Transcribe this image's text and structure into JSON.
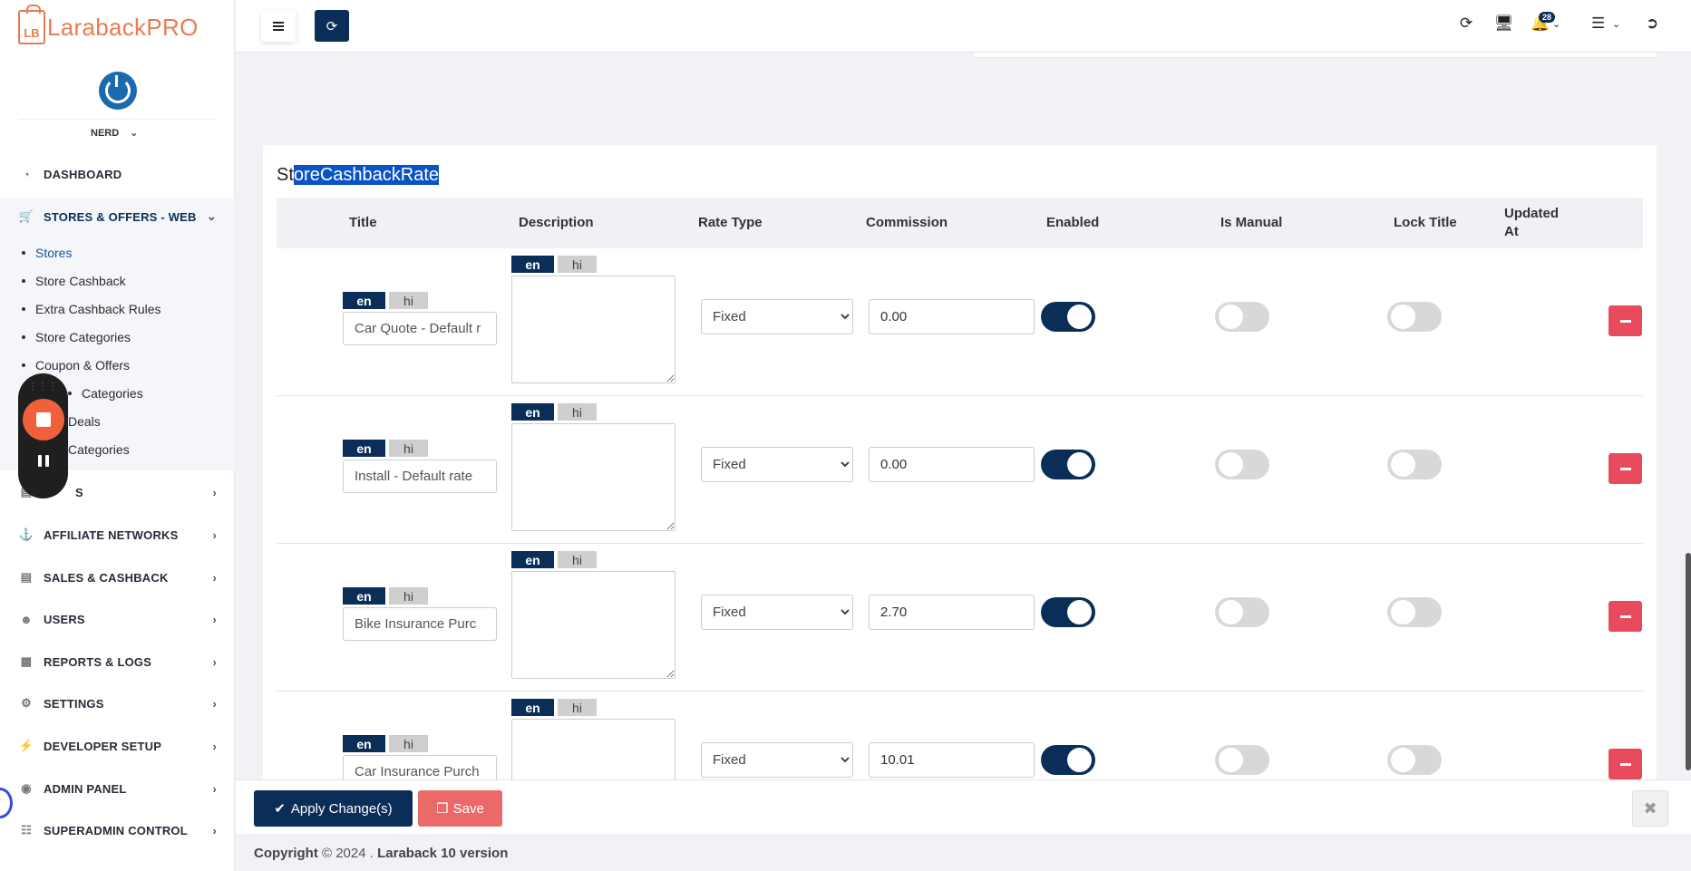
{
  "brand": {
    "logo_mark": "LB",
    "name": "LarabackPRO"
  },
  "user": {
    "name": "NERD"
  },
  "nav": {
    "dashboard": "DASHBOARD",
    "stores_offers": "STORES & OFFERS - WEB",
    "submenu": [
      "Stores",
      "Store Cashback",
      "Extra Cashback Rules",
      "Store Categories",
      "Coupon & Offers",
      "Categories",
      "Deals",
      "Categories"
    ],
    "ms_fragment": "S",
    "affiliate": "AFFILIATE NETWORKS",
    "sales": "SALES & CASHBACK",
    "users": "USERS",
    "reports": "REPORTS & LOGS",
    "settings": "SETTINGS",
    "developer": "DEVELOPER SETUP",
    "admin": "ADMIN PANEL",
    "superadmin": "SUPERADMIN CONTROL"
  },
  "topbar": {
    "notification_count": "28"
  },
  "card": {
    "title_prefix": "St",
    "title_selected": "oreCashbackRate",
    "columns": {
      "title": "Title",
      "description": "Description",
      "rate_type": "Rate Type",
      "commission": "Commission",
      "enabled": "Enabled",
      "is_manual": "Is Manual",
      "lock_title": "Lock Title",
      "updated_at_1": "Updated",
      "updated_at_2": "At"
    },
    "lang_en": "en",
    "lang_hi": "hi",
    "rows": [
      {
        "title": "Car Quote - Default r",
        "rate_type": "Fixed",
        "commission": "0.00",
        "enabled": true,
        "is_manual": false,
        "lock_title": false
      },
      {
        "title": "Install - Default rate",
        "rate_type": "Fixed",
        "commission": "0.00",
        "enabled": true,
        "is_manual": false,
        "lock_title": false
      },
      {
        "title": "Bike Insurance Purc",
        "rate_type": "Fixed",
        "commission": "2.70",
        "enabled": true,
        "is_manual": false,
        "lock_title": false
      },
      {
        "title": "Car Insurance Purch",
        "rate_type": "Fixed",
        "commission": "10.01",
        "enabled": true,
        "is_manual": false,
        "lock_title": false
      }
    ]
  },
  "actions": {
    "apply": "Apply Change(s)",
    "save": "Save"
  },
  "footer": {
    "copyright": "Copyright",
    "year": "© 2024 .",
    "product": "Laraback 10 version"
  }
}
